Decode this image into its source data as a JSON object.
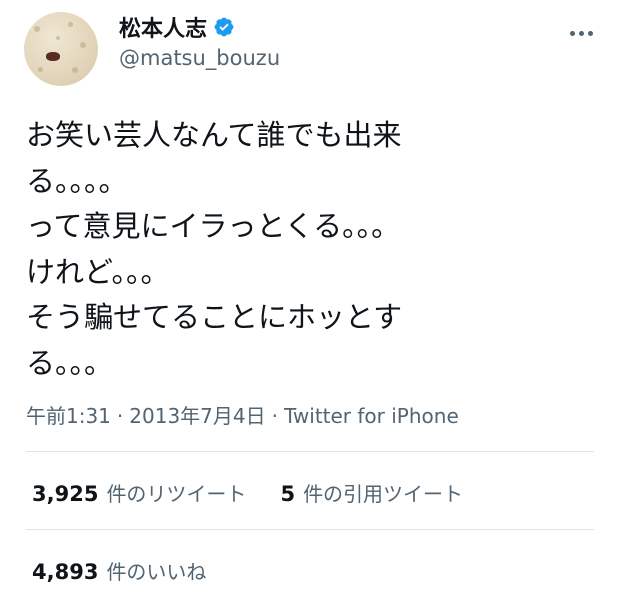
{
  "user": {
    "display_name": "松本人志",
    "handle": "@matsu_bouzu",
    "verified": true,
    "accent_color": "#1d9bf0"
  },
  "tweet": {
    "text": "お笑い芸人なんて誰でも出来\nる。。。。\nって意見にイラっとくる。。。\nけれど。。。\nそう騙せてることにホッとす\nる。。。"
  },
  "meta": {
    "time": "午前1:31",
    "separator": "·",
    "date": "2013年7月4日",
    "source": "Twitter for iPhone"
  },
  "stats": {
    "retweets_count": "3,925",
    "retweets_label": "件のリツイート",
    "quotes_count": "5",
    "quotes_label": "件の引用ツイート",
    "likes_count": "4,893",
    "likes_label": "件のいいね"
  },
  "icons": {
    "more": "more-horizontal-icon",
    "verified": "verified-badge-icon"
  }
}
